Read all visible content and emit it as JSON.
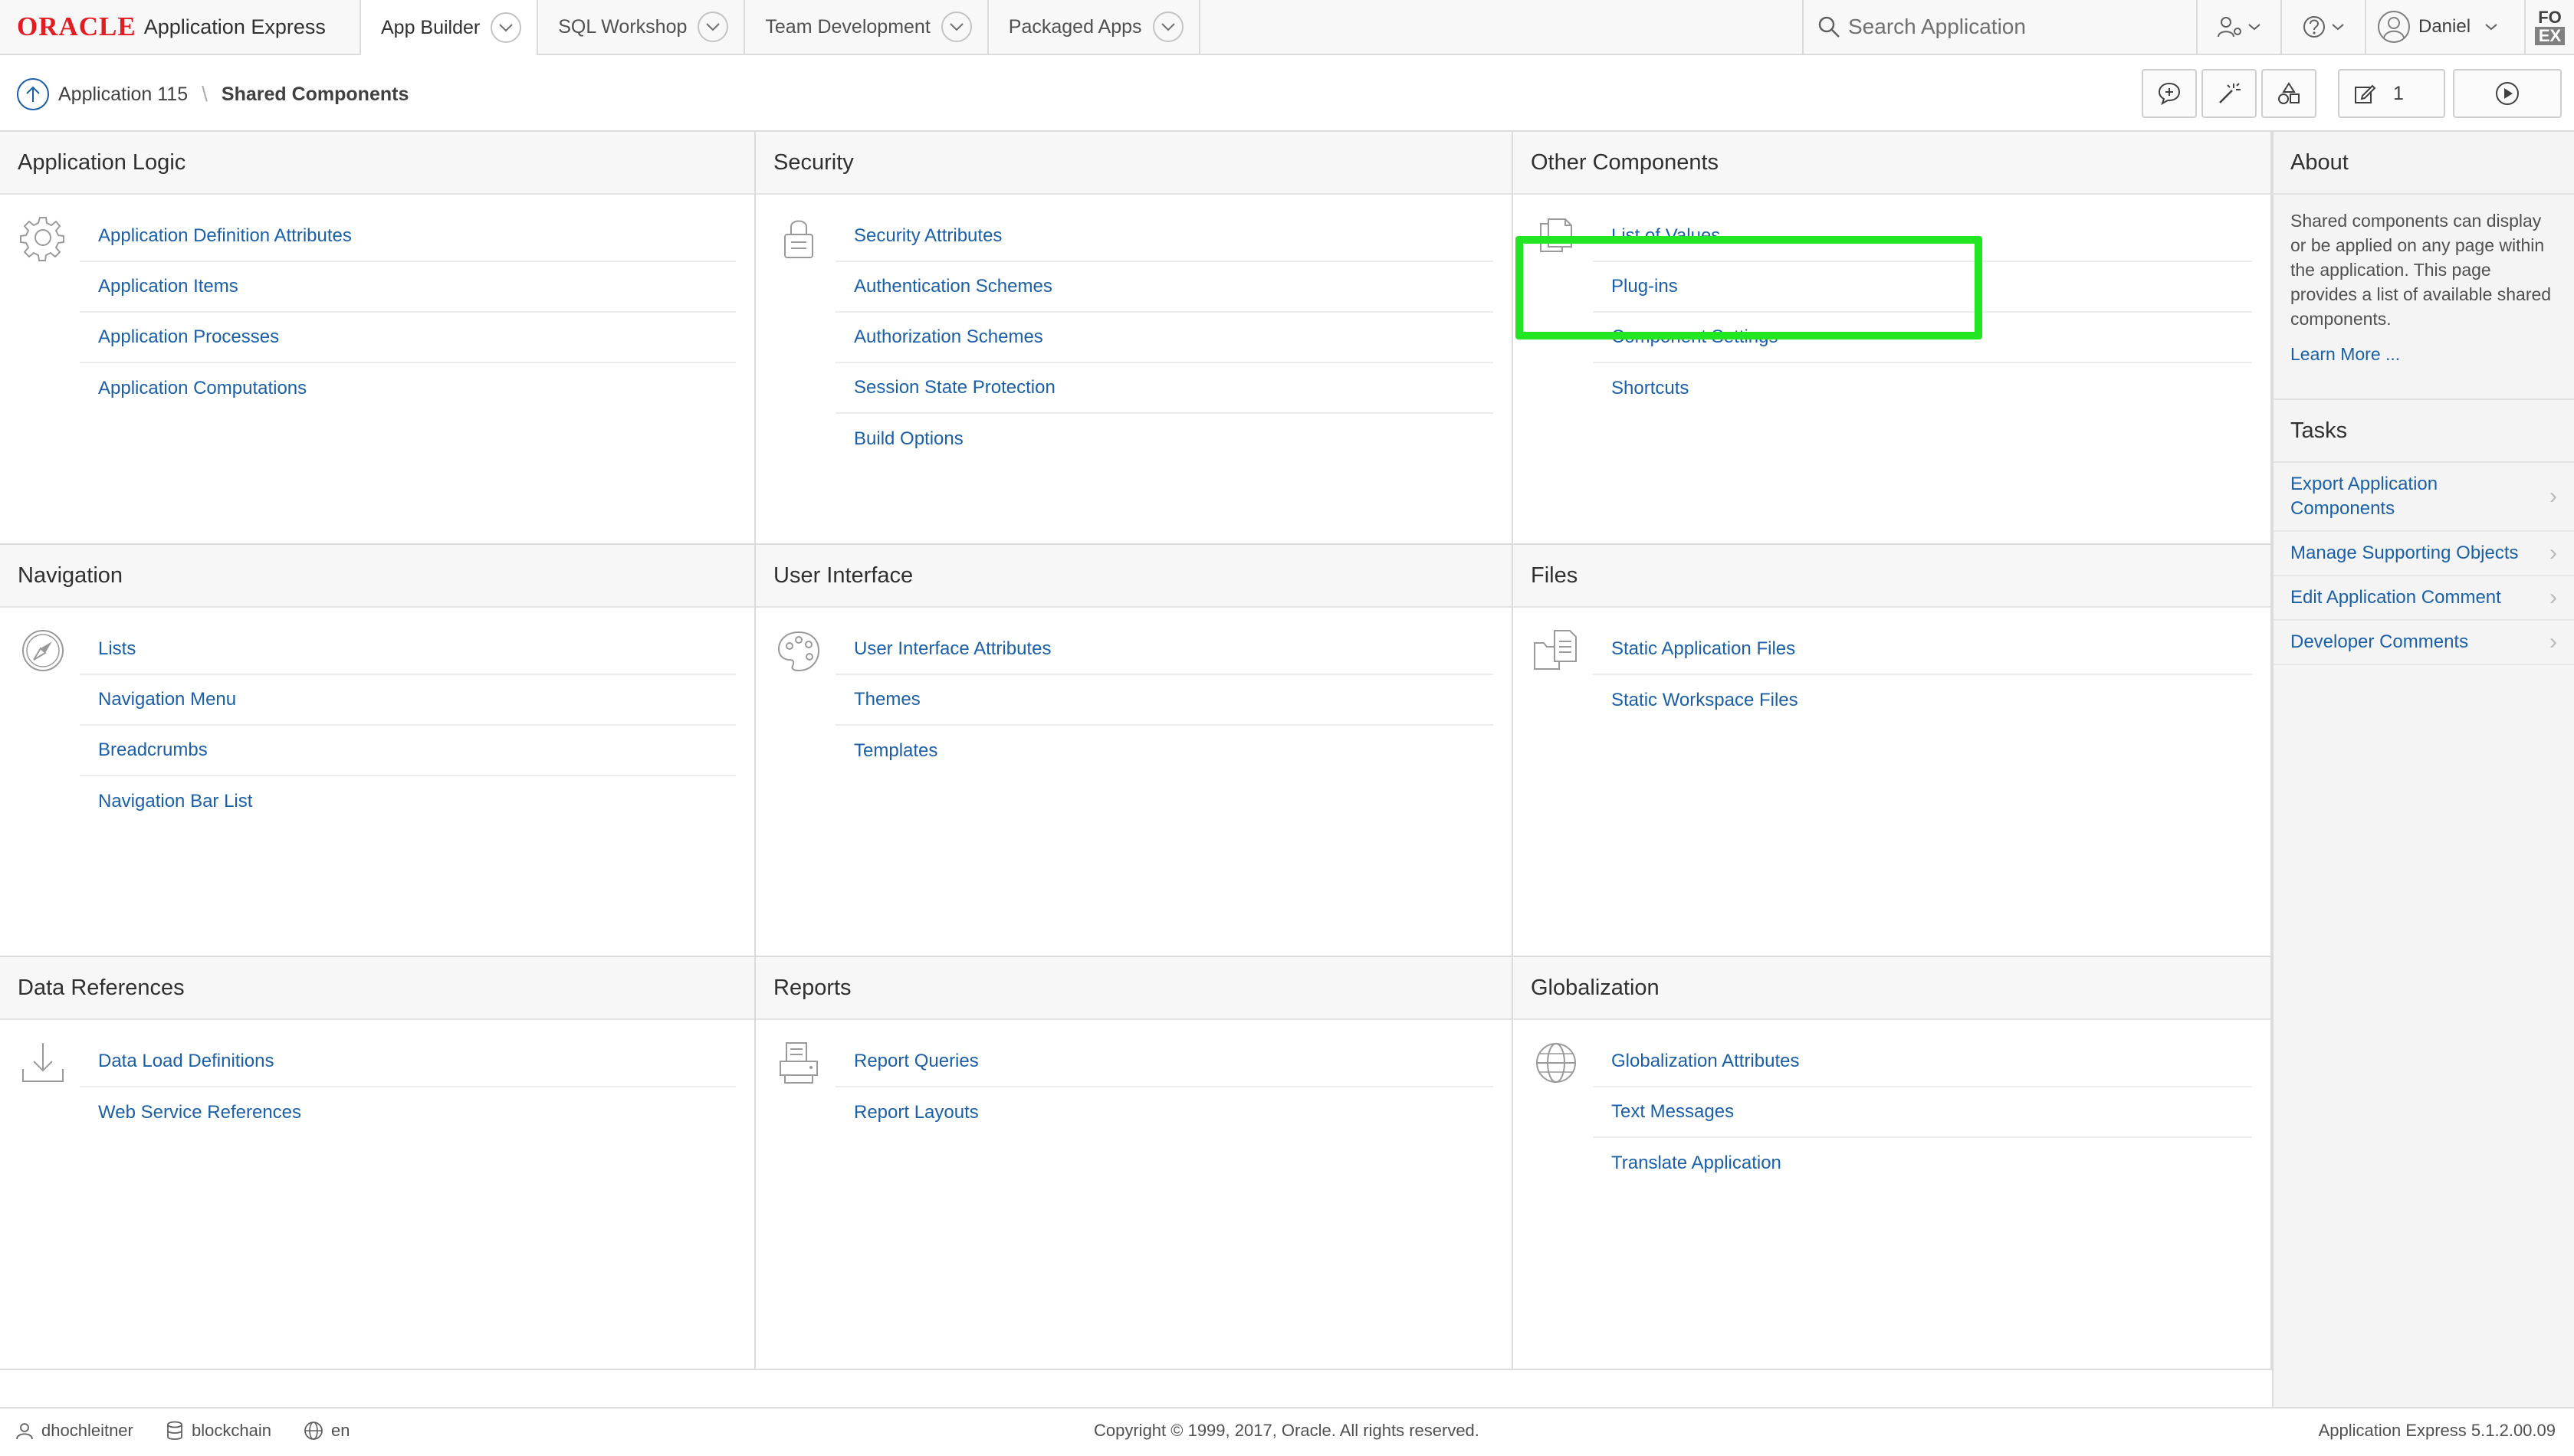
{
  "header": {
    "logo_brand": "ORACLE",
    "logo_product": "Application Express",
    "tabs": [
      {
        "label": "App Builder",
        "active": true
      },
      {
        "label": "SQL Workshop",
        "active": false
      },
      {
        "label": "Team Development",
        "active": false
      },
      {
        "label": "Packaged Apps",
        "active": false
      }
    ],
    "search_placeholder": "Search Application",
    "user_name": "Daniel",
    "corner_badge_top": "FO",
    "corner_badge_bottom": "EX"
  },
  "breadcrumb": {
    "parent": "Application 115",
    "current": "Shared Components"
  },
  "toolbar": {
    "edit_count": "1"
  },
  "panels": [
    {
      "title": "Application Logic",
      "icon": "gear-icon",
      "links": [
        "Application Definition Attributes",
        "Application Items",
        "Application Processes",
        "Application Computations"
      ]
    },
    {
      "title": "Security",
      "icon": "lock-icon",
      "links": [
        "Security Attributes",
        "Authentication Schemes",
        "Authorization Schemes",
        "Session State Protection",
        "Build Options"
      ]
    },
    {
      "title": "Other Components",
      "icon": "documents-icon",
      "links": [
        "List of Values",
        "Plug-ins",
        "Component Settings",
        "Shortcuts"
      ]
    },
    {
      "title": "Navigation",
      "icon": "compass-icon",
      "links": [
        "Lists",
        "Navigation Menu",
        "Breadcrumbs",
        "Navigation Bar List"
      ]
    },
    {
      "title": "User Interface",
      "icon": "palette-icon",
      "links": [
        "User Interface Attributes",
        "Themes",
        "Templates"
      ]
    },
    {
      "title": "Files",
      "icon": "folder-file-icon",
      "links": [
        "Static Application Files",
        "Static Workspace Files"
      ]
    },
    {
      "title": "Data References",
      "icon": "download-icon",
      "links": [
        "Data Load Definitions",
        "Web Service References"
      ]
    },
    {
      "title": "Reports",
      "icon": "printer-icon",
      "links": [
        "Report Queries",
        "Report Layouts"
      ]
    },
    {
      "title": "Globalization",
      "icon": "globe-icon",
      "links": [
        "Globalization Attributes",
        "Text Messages",
        "Translate Application"
      ]
    }
  ],
  "sidebar": {
    "about_title": "About",
    "about_text": "Shared components can display or be applied on any page within the application. This page provides a list of available shared components.",
    "learn_more": "Learn More ...",
    "tasks_title": "Tasks",
    "tasks": [
      "Export Application Components",
      "Manage Supporting Objects",
      "Edit Application Comment",
      "Developer Comments"
    ]
  },
  "footer": {
    "user": "dhochleitner",
    "workspace": "blockchain",
    "language": "en",
    "copyright": "Copyright © 1999, 2017, Oracle. All rights reserved.",
    "version": "Application Express 5.1.2.00.09"
  },
  "colors": {
    "link": "#1a5fa8",
    "oracle_red": "#e31b23",
    "highlight": "#22e622"
  }
}
